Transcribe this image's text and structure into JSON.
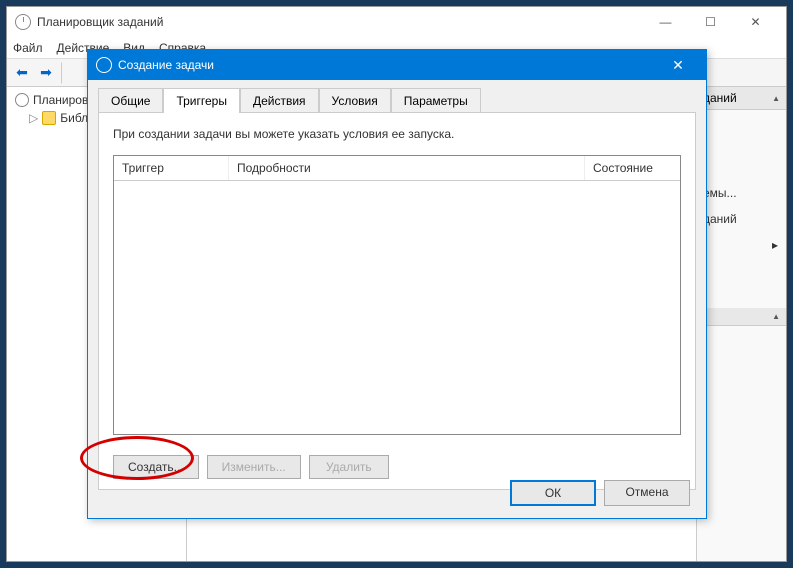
{
  "main_window": {
    "title": "Планировщик заданий",
    "menu": {
      "file": "Файл",
      "action": "Действие",
      "view": "Вид",
      "help": "Справка"
    },
    "tree": {
      "root": "Планировщик заданий",
      "lib": "Библиотека"
    },
    "actions_pane": {
      "header_suffix": "даний",
      "item_system": "емы...",
      "item_disable": "даний"
    }
  },
  "dialog": {
    "title": "Создание задачи",
    "tabs": [
      "Общие",
      "Триггеры",
      "Действия",
      "Условия",
      "Параметры"
    ],
    "description": "При создании задачи вы можете указать условия ее запуска.",
    "columns": {
      "trigger": "Триггер",
      "details": "Подробности",
      "state": "Состояние"
    },
    "buttons": {
      "create": "Создать...",
      "edit": "Изменить...",
      "delete": "Удалить"
    },
    "ok": "ОК",
    "cancel": "Отмена"
  }
}
